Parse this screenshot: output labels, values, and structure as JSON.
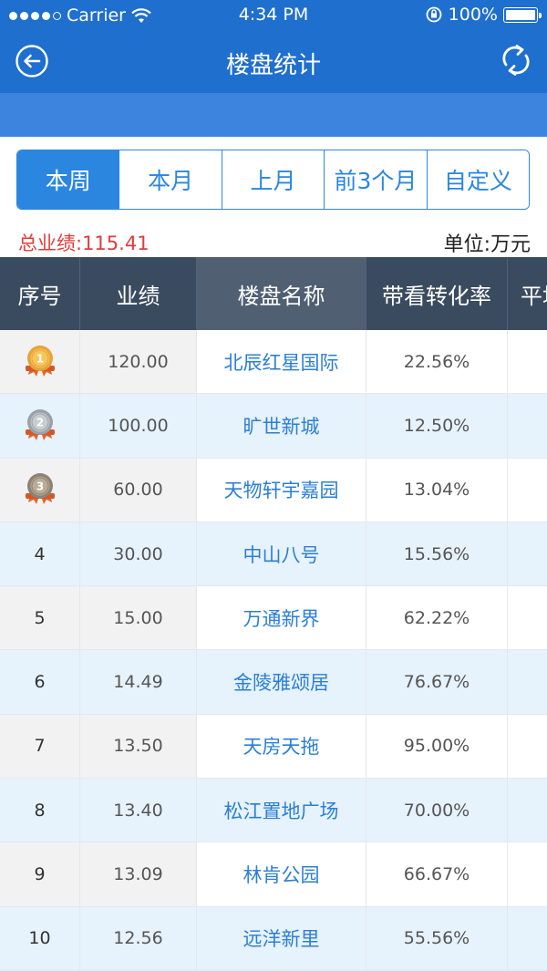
{
  "status_bar": {
    "carrier": "Carrier",
    "time": "4:34 PM",
    "battery": "100%"
  },
  "nav": {
    "title": "楼盘统计",
    "back_icon": "back-arrow-icon",
    "refresh_icon": "refresh-icon"
  },
  "segments": [
    {
      "label": "本周",
      "active": true
    },
    {
      "label": "本月",
      "active": false
    },
    {
      "label": "上月",
      "active": false
    },
    {
      "label": "前3个月",
      "active": false
    },
    {
      "label": "自定义",
      "active": false
    }
  ],
  "summary": {
    "total": "总业绩:115.41",
    "unit": "单位:万元"
  },
  "table": {
    "headers": [
      "序号",
      "业绩",
      "楼盘名称",
      "带看转化率",
      "平均"
    ],
    "rows": [
      {
        "rank": "1",
        "medal": "gold",
        "perf": "120.00",
        "name": "北辰红星国际",
        "conv": "22.56%"
      },
      {
        "rank": "2",
        "medal": "silver",
        "perf": "100.00",
        "name": "旷世新城",
        "conv": "12.50%"
      },
      {
        "rank": "3",
        "medal": "bronze",
        "perf": "60.00",
        "name": "天物轩宇嘉园",
        "conv": "13.04%"
      },
      {
        "rank": "4",
        "medal": "",
        "perf": "30.00",
        "name": "中山八号",
        "conv": "15.56%"
      },
      {
        "rank": "5",
        "medal": "",
        "perf": "15.00",
        "name": "万通新界",
        "conv": "62.22%"
      },
      {
        "rank": "6",
        "medal": "",
        "perf": "14.49",
        "name": "金陵雅颂居",
        "conv": "76.67%"
      },
      {
        "rank": "7",
        "medal": "",
        "perf": "13.50",
        "name": "天房天拖",
        "conv": "95.00%"
      },
      {
        "rank": "8",
        "medal": "",
        "perf": "13.40",
        "name": "松江置地广场",
        "conv": "70.00%"
      },
      {
        "rank": "9",
        "medal": "",
        "perf": "13.09",
        "name": "林肯公园",
        "conv": "66.67%"
      },
      {
        "rank": "10",
        "medal": "",
        "perf": "12.56",
        "name": "远洋新里",
        "conv": "55.56%"
      }
    ]
  },
  "colors": {
    "nav": "#1f6fce",
    "accent": "#2b86e0",
    "header": "#3b4b5f",
    "total": "#e23b3b"
  }
}
